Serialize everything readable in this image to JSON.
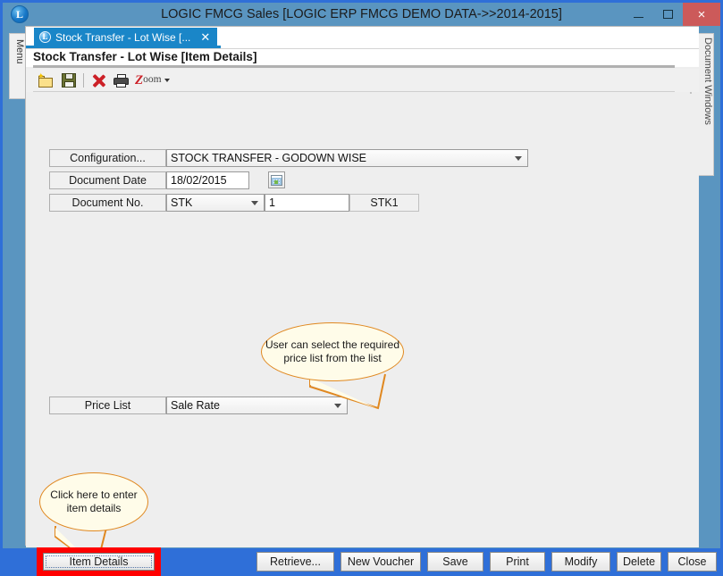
{
  "window": {
    "title": "LOGIC FMCG Sales  [LOGIC ERP FMCG DEMO DATA->>2014-2015]",
    "logo_letter": "L",
    "logo_icon": "logic-logo-icon",
    "minimize_icon": "minimize-icon",
    "maximize_icon": "maximize-icon",
    "close_icon": "close-icon",
    "close_glyph": "×",
    "accent_blue": "#5a95c0",
    "frame_blue": "#2f6fd8",
    "close_red": "#cc5a5a"
  },
  "rails": {
    "menu_label": "Menu",
    "document_windows_label": "Document Windows"
  },
  "tab_strip": {
    "active_tab": {
      "label": "Stock Transfer - Lot Wise [...",
      "logo_letter": "L",
      "close_glyph": "✕"
    },
    "tab_menu_icon": "chevron-down-icon",
    "underline_color": "#1a86c8"
  },
  "form": {
    "title": "Stock Transfer - Lot Wise [Item Details]",
    "toolbar": [
      {
        "name": "new-document-icon",
        "tooltip": "New"
      },
      {
        "name": "save-icon",
        "tooltip": "Save"
      },
      {
        "name": "delete-icon",
        "tooltip": "Delete"
      },
      {
        "name": "print-icon",
        "tooltip": "Print"
      },
      {
        "name": "zoom-icon",
        "label": "Zoom",
        "big_letter": "Z",
        "rest": "oom"
      }
    ],
    "fields": {
      "configuration": {
        "label": "Configuration...",
        "value": "STOCK TRANSFER - GODOWN WISE"
      },
      "document_date": {
        "label": "Document Date",
        "value": "18/02/2015",
        "calendar_icon": "calendar-icon"
      },
      "document_no": {
        "label": "Document No.",
        "prefix": "STK",
        "number": "1",
        "full": "STK1"
      },
      "price_list": {
        "label": "Price List",
        "value": "Sale Rate"
      }
    },
    "callouts": [
      {
        "id": "price-list-callout",
        "text": "User can select the required price list from the list",
        "border_color": "#e08820",
        "fill_color": "#fffce9"
      },
      {
        "id": "item-details-callout",
        "text": "Click here to enter item details",
        "border_color": "#e08820",
        "fill_color": "#fffce9"
      }
    ],
    "item_details_button": {
      "label": "Item Details",
      "highlight_color": "#ff0000"
    },
    "actions": [
      {
        "name": "retrieve-button",
        "label": "Retrieve..."
      },
      {
        "name": "new-voucher-button",
        "label": "New Voucher"
      },
      {
        "name": "save-button",
        "label": "Save"
      },
      {
        "name": "print-button",
        "label": "Print"
      },
      {
        "name": "modify-button",
        "label": "Modify"
      },
      {
        "name": "delete-button",
        "label": "Delete"
      },
      {
        "name": "close-button",
        "label": "Close"
      }
    ]
  }
}
